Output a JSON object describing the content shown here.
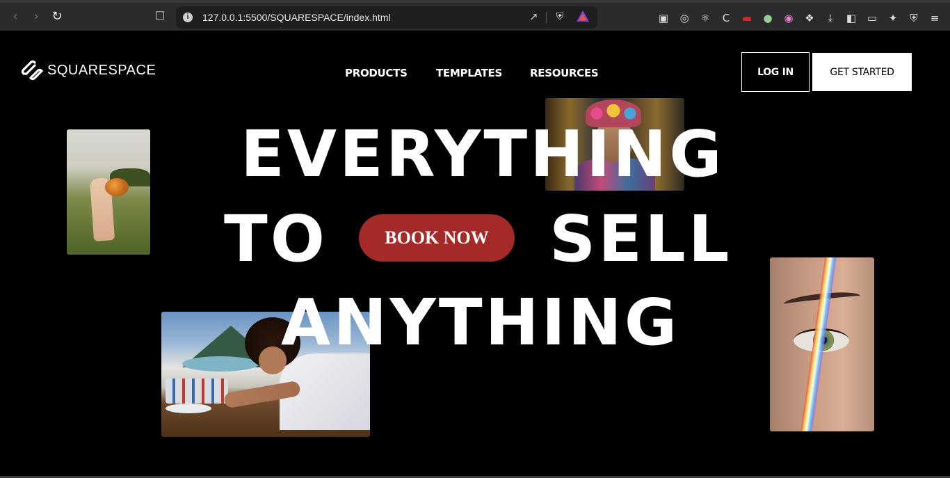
{
  "browser": {
    "url": "127.0.0.1:5500/SQUARESPACE/index.html"
  },
  "brand": {
    "name": "SQUARESPACE"
  },
  "nav": {
    "items": [
      {
        "label": "PRODUCTS"
      },
      {
        "label": "TEMPLATES"
      },
      {
        "label": "RESOURCES"
      }
    ],
    "login_label": "LOG IN",
    "get_started_label": "GET STARTED"
  },
  "hero": {
    "line1": "EVERYTHING",
    "line2_left": "TO",
    "line2_right": "SELL",
    "line3": "ANYTHING",
    "cta_label": "BOOK NOW"
  },
  "colors": {
    "background": "#000000",
    "cta": "#a42a28",
    "text": "#ffffff"
  },
  "images": [
    {
      "name": "bride-in-field-photo"
    },
    {
      "name": "frida-portrait-photo"
    },
    {
      "name": "eye-rainbow-photo"
    },
    {
      "name": "painter-photo"
    }
  ]
}
